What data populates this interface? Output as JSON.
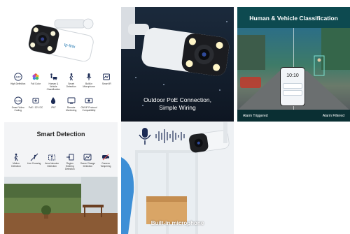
{
  "tiles": {
    "product": {
      "brand": "tp-link",
      "features": [
        {
          "icon": "resolution-4mp-icon",
          "label": "High Definition"
        },
        {
          "icon": "color-wheel-icon",
          "label": "Full Color"
        },
        {
          "icon": "human-vehicle-icon",
          "label": "Human & Vehicle Classification"
        },
        {
          "icon": "smart-detection-icon",
          "label": "Smart Detection"
        },
        {
          "icon": "microphone-icon",
          "label": "Built-in Microphone"
        },
        {
          "icon": "smart-ir-icon",
          "label": "Smart IR"
        },
        {
          "icon": "night-vision-icon",
          "label": "Smart Video Coding"
        },
        {
          "icon": "poe-icon",
          "label": "PoE / 12V DC"
        },
        {
          "icon": "ip67-icon",
          "label": "IP67"
        },
        {
          "icon": "remote-icon",
          "label": "Remote Monitoring"
        },
        {
          "icon": "onvif-icon",
          "label": "ONVIF Protocol Compatibility"
        }
      ]
    },
    "outdoor": {
      "caption_line1": "Outdoor PoE Connection,",
      "caption_line2": "Simple Wiring"
    },
    "classification": {
      "title": "Human & Vehicle Classification",
      "phone_time": "10:10",
      "left_label": "Alarm Triggered",
      "right_label": "Alarm Filtered"
    },
    "smart_detection": {
      "title": "Smart Detection",
      "items": [
        {
          "icon": "motion-detection-icon",
          "label": "Motion Detection"
        },
        {
          "icon": "line-crossing-icon",
          "label": "Line Crossing"
        },
        {
          "icon": "area-intrusion-icon",
          "label": "Area Intrusion Detection"
        },
        {
          "icon": "region-entering-icon",
          "label": "Region Entering Detection"
        },
        {
          "icon": "scene-change-icon",
          "label": "Scene Change Detection"
        },
        {
          "icon": "camera-tampering-icon",
          "label": "Camera Tampering"
        }
      ]
    },
    "microphone": {
      "caption": "Built-in microphone"
    }
  },
  "colors": {
    "classification_bg": "#0f3b3f",
    "outdoor_bg": "#1b2a3c",
    "led_glow": "#fff6c8"
  }
}
